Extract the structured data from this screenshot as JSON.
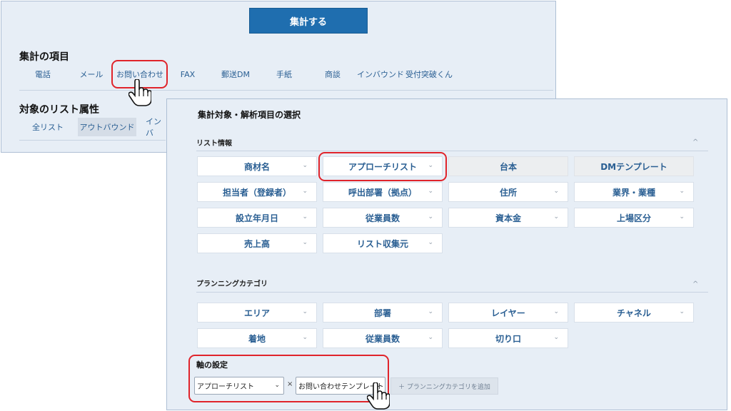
{
  "calc_button": "集計する",
  "aggregate_section": {
    "title": "集計の項目",
    "tabs": [
      "電話",
      "メール",
      "お問い合わせ",
      "FAX",
      "郵送DM",
      "手紙",
      "商談",
      "インバウンド",
      "受付突破くん"
    ]
  },
  "list_attr_section": {
    "title": "対象のリスト属性",
    "tabs": [
      "全リスト",
      "アウトバウンド",
      "インバ"
    ]
  },
  "panel": {
    "title": "集計対象・解析項目の選択",
    "list_info": {
      "label": "リスト情報",
      "items": [
        "商材名",
        "アプローチリスト",
        "台本",
        "DMテンプレート",
        "担当者（登録者）",
        "呼出部署（拠点）",
        "住所",
        "業界・業種",
        "設立年月日",
        "従業員数",
        "資本金",
        "上場区分",
        "売上高",
        "リスト収集元"
      ]
    },
    "planning": {
      "label": "プランニングカテゴリ",
      "items": [
        "エリア",
        "部署",
        "レイヤー",
        "チャネル",
        "着地",
        "従業員数",
        "切り口"
      ]
    },
    "axis": {
      "label": "軸の設定",
      "select1": "アプローチリスト",
      "times": "×",
      "select2": "お問い合わせテンプレート",
      "add_button": "＋ プランニングカテゴリを追加"
    }
  },
  "icons": {
    "chevron": "⌄",
    "collapse": "^"
  }
}
